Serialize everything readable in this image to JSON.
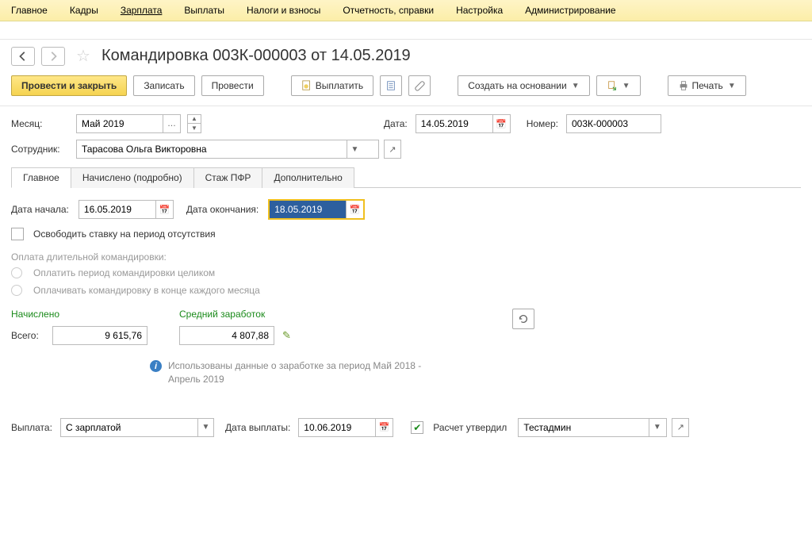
{
  "menu": {
    "items": [
      "Главное",
      "Кадры",
      "Зарплата",
      "Выплаты",
      "Налоги и взносы",
      "Отчетность, справки",
      "Настройка",
      "Администрирование"
    ],
    "active_index": 2
  },
  "title": "Командировка 003К-000003 от 14.05.2019",
  "toolbar": {
    "post_and_close": "Провести и закрыть",
    "save": "Записать",
    "post": "Провести",
    "pay": "Выплатить",
    "create_based": "Создать на основании",
    "print": "Печать"
  },
  "form": {
    "month_label": "Месяц:",
    "month_value": "Май 2019",
    "date_label": "Дата:",
    "date_value": "14.05.2019",
    "number_label": "Номер:",
    "number_value": "003К-000003",
    "employee_label": "Сотрудник:",
    "employee_value": "Тарасова Ольга Викторовна"
  },
  "tabs": [
    "Главное",
    "Начислено (подробно)",
    "Стаж ПФР",
    "Дополнительно"
  ],
  "main_tab": {
    "start_date_label": "Дата начала:",
    "start_date": "16.05.2019",
    "end_date_label": "Дата окончания:",
    "end_date": "18.05.2019",
    "free_rate": "Освободить ставку на период отсутствия",
    "long_trip_label": "Оплата длительной командировки:",
    "pay_full": "Оплатить период командировки целиком",
    "pay_monthly": "Оплачивать командировку в конце каждого месяца",
    "accrued_label": "Начислено",
    "total_label": "Всего:",
    "total_value": "9 615,76",
    "avg_label": "Средний заработок",
    "avg_value": "4 807,88",
    "info_text": "Использованы данные о заработке за период Май 2018 - Апрель 2019"
  },
  "payout": {
    "label": "Выплата:",
    "value": "С зарплатой",
    "date_label": "Дата выплаты:",
    "date_value": "10.06.2019",
    "approved_label": "Расчет утвердил",
    "approver": "Тестадмин"
  }
}
